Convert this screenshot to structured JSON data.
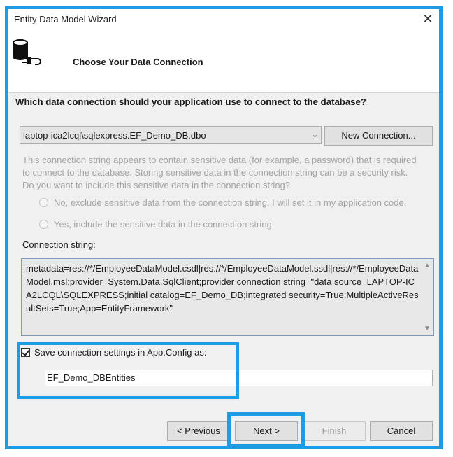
{
  "window": {
    "title": "Entity Data Model Wizard",
    "close_glyph": "✕"
  },
  "header": {
    "title": "Choose Your Data Connection",
    "icon": "database-plug-icon"
  },
  "question": "Which data connection should your application use to connect to the database?",
  "connection_select": {
    "value": "laptop-ica2lcql\\sqlexpress.EF_Demo_DB.dbo"
  },
  "new_connection_label": "New Connection...",
  "sensitive_notice": "This connection string appears to contain sensitive data (for example, a password) that is required to connect to the database. Storing sensitive data in the connection string can be a security risk. Do you want to include this sensitive data in the connection string?",
  "radio_options": [
    {
      "label": "No, exclude sensitive data from the connection string. I will set it in my application code.",
      "selected": false
    },
    {
      "label": "Yes, include the sensitive data in the connection string.",
      "selected": false
    }
  ],
  "connection_string_label": "Connection string:",
  "connection_string": "metadata=res://*/EmployeeDataModel.csdl|res://*/EmployeeDataModel.ssdl|res://*/EmployeeDataModel.msl;provider=System.Data.SqlClient;provider connection string=\"data source=LAPTOP-ICA2LCQL\\SQLEXPRESS;initial catalog=EF_Demo_DB;integrated security=True;MultipleActiveResultSets=True;App=EntityFramework\"",
  "save_settings": {
    "label": "Save connection settings in App.Config as:",
    "checked": true,
    "value": "EF_Demo_DBEntities"
  },
  "buttons": {
    "previous": "< Previous",
    "next": "Next >",
    "finish": "Finish",
    "cancel": "Cancel"
  },
  "colors": {
    "highlight": "#1c9ce6",
    "dialog_bg": "#f0f0f0",
    "disabled_text": "#a3a3a3"
  }
}
